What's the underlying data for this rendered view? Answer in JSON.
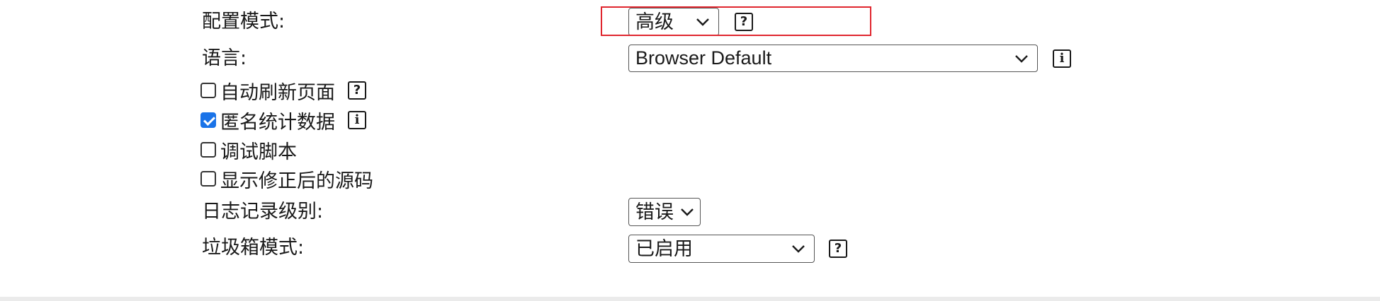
{
  "settings": {
    "config_mode": {
      "label": "配置模式:",
      "value": "高级",
      "help_glyph": "?"
    },
    "language": {
      "label": "语言:",
      "value": "Browser Default",
      "info_glyph": "i"
    },
    "auto_refresh": {
      "label": "自动刷新页面",
      "checked": false,
      "help_glyph": "?"
    },
    "anonymous_stats": {
      "label": "匿名统计数据",
      "checked": true,
      "info_glyph": "i"
    },
    "debug_scripts": {
      "label": "调试脚本",
      "checked": false
    },
    "show_patched_source": {
      "label": "显示修正后的源码",
      "checked": false
    },
    "log_level": {
      "label": "日志记录级别:",
      "value": "错误"
    },
    "trash_mode": {
      "label": "垃圾箱模式:",
      "value": "已启用",
      "help_glyph": "?"
    }
  },
  "colors": {
    "highlight": "#e0262e",
    "checkbox_accent": "#1a73e8"
  },
  "icons": {
    "dropdown": "chevron-down-icon",
    "help": "question-icon",
    "info": "info-icon"
  }
}
